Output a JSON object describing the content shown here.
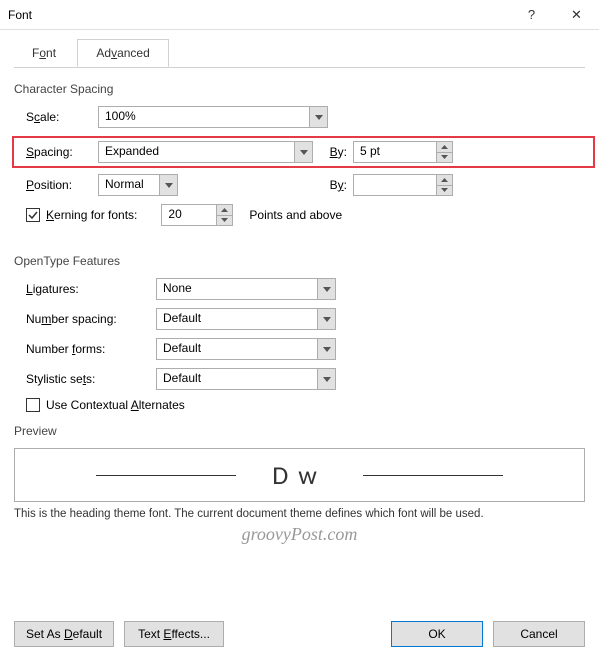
{
  "window": {
    "title": "Font",
    "help": "?",
    "close": "✕"
  },
  "tabs": {
    "font": "Font",
    "advanced": "Advanced"
  },
  "charSpacing": {
    "groupLabel": "Character Spacing",
    "scaleLabel": "Scale:",
    "scaleValue": "100%",
    "spacingLabel": "Spacing:",
    "spacingValue": "Expanded",
    "byLabel": "By:",
    "byValue": "5 pt",
    "positionLabel": "Position:",
    "positionValue": "Normal",
    "by2Label": "By:",
    "by2Value": "",
    "kerningLabel": "Kerning for fonts:",
    "kerningValue": "20",
    "pointsLabel": "Points and above"
  },
  "opentype": {
    "groupLabel": "OpenType Features",
    "ligaturesLabel": "Ligatures:",
    "ligaturesValue": "None",
    "numSpacingLabel": "Number spacing:",
    "numSpacingValue": "Default",
    "numFormsLabel": "Number forms:",
    "numFormsValue": "Default",
    "styleSetsLabel": "Stylistic sets:",
    "styleSetsValue": "Default",
    "contextualLabel": "Use Contextual Alternates"
  },
  "preview": {
    "label": "Preview",
    "sample": "Dw",
    "note": "This is the heading theme font. The current document theme defines which font will be used."
  },
  "watermark": "groovyPost.com",
  "buttons": {
    "setDefault": "Set As Default",
    "textEffects": "Text Effects...",
    "ok": "OK",
    "cancel": "Cancel"
  }
}
